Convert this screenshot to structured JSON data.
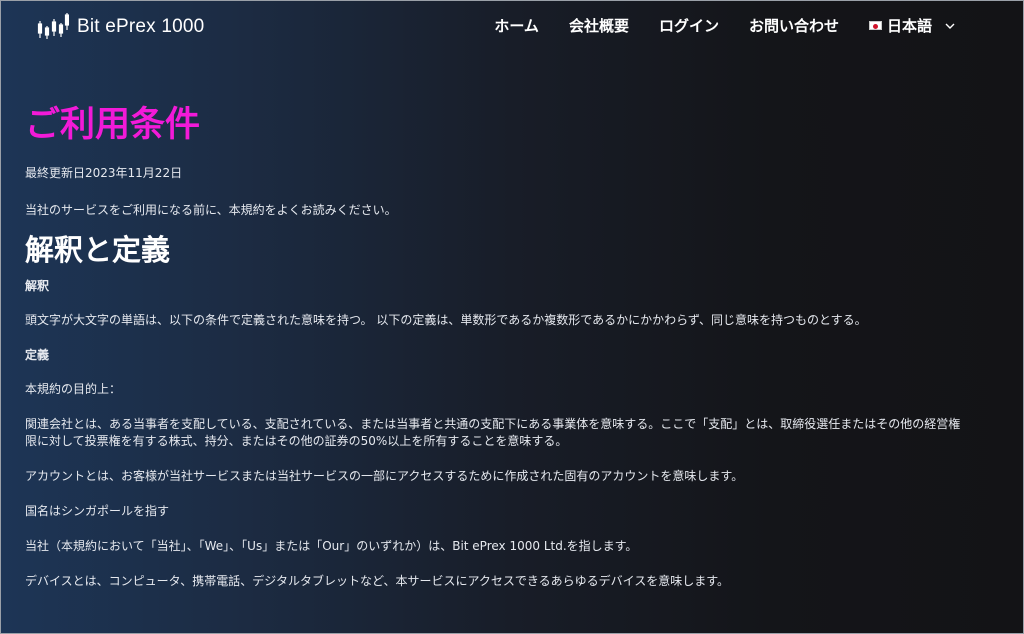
{
  "header": {
    "brand": "Bit ePrex 1000",
    "nav": {
      "home": "ホーム",
      "about": "会社概要",
      "login": "ログイン",
      "contact": "お問い合わせ",
      "language": "日本語"
    },
    "flag_icon": "japan-flag-icon",
    "dropdown_icon": "chevron-down-icon",
    "logo_icon": "candlestick-chart-icon"
  },
  "content": {
    "title": "ご利用条件",
    "last_updated": "最終更新日2023年11月22日",
    "intro": "当社のサービスをご利用になる前に、本規約をよくお読みください。",
    "section_heading": "解釈と定義",
    "interpretation_heading": "解釈",
    "interpretation_text": "頭文字が大文字の単語は、以下の条件で定義された意味を持つ。 以下の定義は、単数形であるか複数形であるかにかかわらず、同じ意味を持つものとする。",
    "definitions_heading": "定義",
    "definitions_lead": "本規約の目的上：",
    "affiliate_line1": "関連会社とは、ある当事者を支配している、支配されている、または当事者と共通の支配下にある事業体を意味する。ここで「支配」とは、取締役選任またはその他の経営権",
    "affiliate_line2": "限に対して投票権を有する株式、持分、またはその他の証券の50%以上を所有することを意味する。",
    "account": "アカウントとは、お客様が当社サービスまたは当社サービスの一部にアクセスするために作成された固有のアカウントを意味します。",
    "country": "国名はシンガポールを指す",
    "company": "当社（本規約において「当社」、「We」、「Us」または「Our」のいずれか）は、Bit ePrex 1000 Ltd.を指します。",
    "device": "デバイスとは、コンピュータ、携帯電話、デジタルタブレットなど、本サービスにアクセスできるあらゆるデバイスを意味します。"
  },
  "colors": {
    "title_accent": "#f21ad8",
    "flag_red": "#d0142b",
    "text": "#e6e9ef"
  }
}
